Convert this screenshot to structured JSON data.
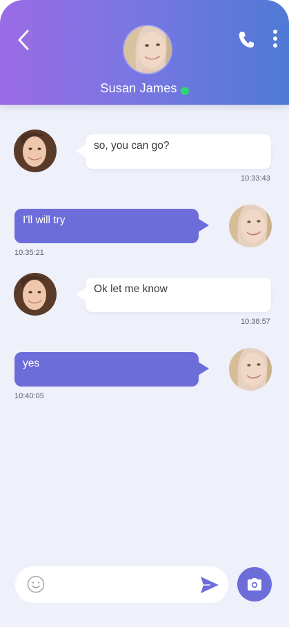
{
  "header": {
    "contact_name": "Susan James",
    "status": "online",
    "back_icon": "chevron-left-icon",
    "call_icon": "phone-icon",
    "menu_icon": "more-vertical-icon",
    "online_color": "#2ed573"
  },
  "messages": [
    {
      "direction": "incoming",
      "text": "so, you can go?",
      "time": "10:33:43"
    },
    {
      "direction": "outgoing",
      "text": "I'll will try",
      "time": "10:35:21"
    },
    {
      "direction": "incoming",
      "text": "Ok let me know",
      "time": "10:38:57"
    },
    {
      "direction": "outgoing",
      "text": "yes",
      "time": "10:40:05"
    }
  ],
  "composer": {
    "placeholder": "",
    "value": "",
    "emoji_icon": "smiley-icon",
    "send_icon": "send-icon",
    "camera_icon": "camera-icon"
  },
  "colors": {
    "accent": "#6c6dd9",
    "header_gradient_start": "#9b6be6",
    "header_gradient_end": "#4f7ad6",
    "background": "#eef0fa"
  }
}
